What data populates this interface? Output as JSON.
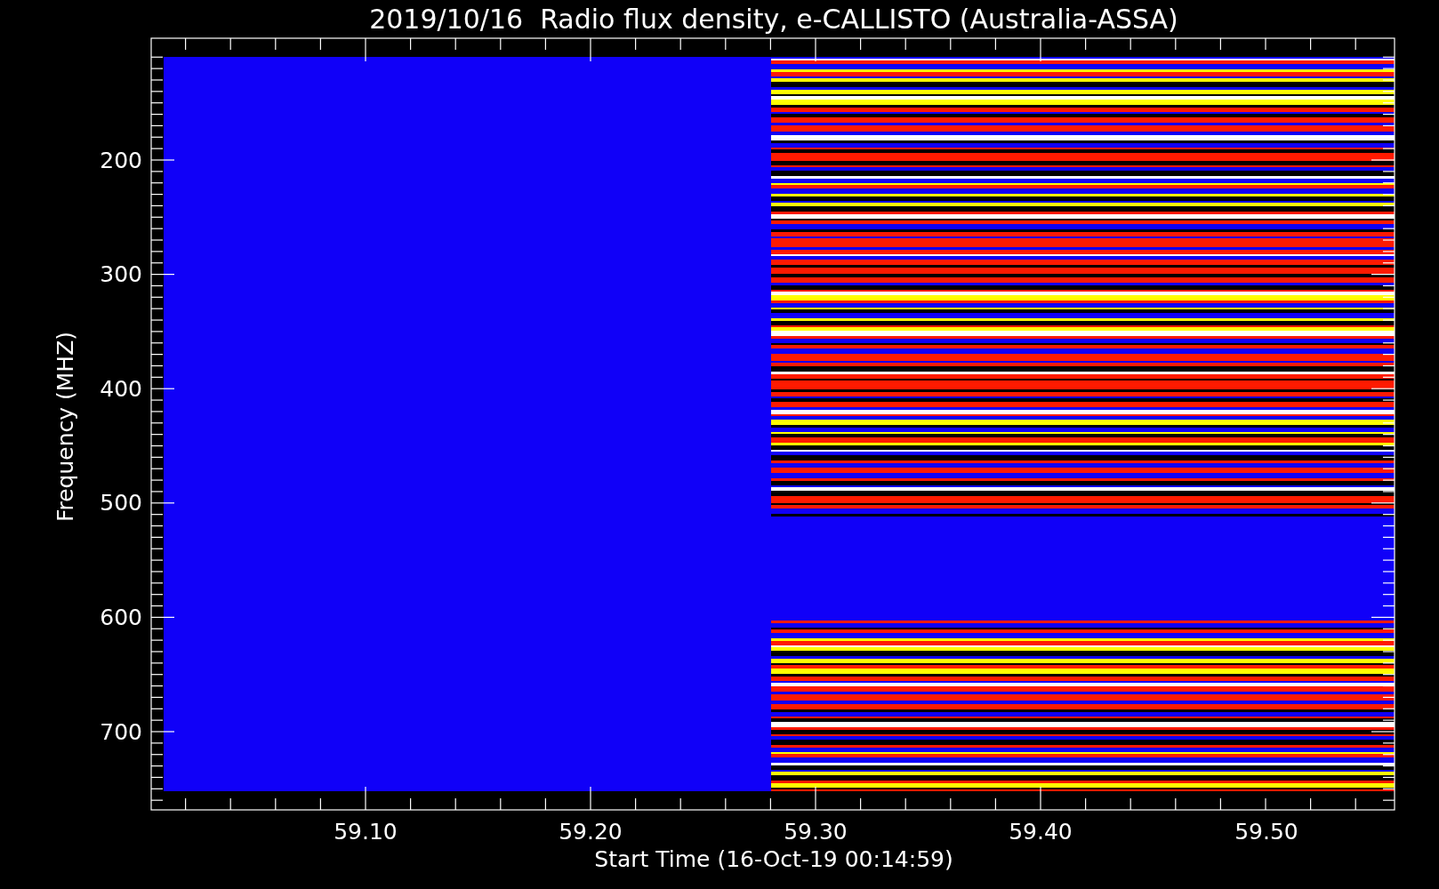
{
  "title": "2019/10/16  Radio flux density, e-CALLISTO (Australia-ASSA)",
  "y_axis": {
    "label": "Frequency (MHZ)",
    "ticks": [
      "200",
      "300",
      "400",
      "500",
      "600",
      "700"
    ]
  },
  "x_axis": {
    "label": "Start Time (16-Oct-19 00:14:59)",
    "ticks": [
      "59.10",
      "59.20",
      "59.30",
      "59.40",
      "59.50"
    ]
  }
}
